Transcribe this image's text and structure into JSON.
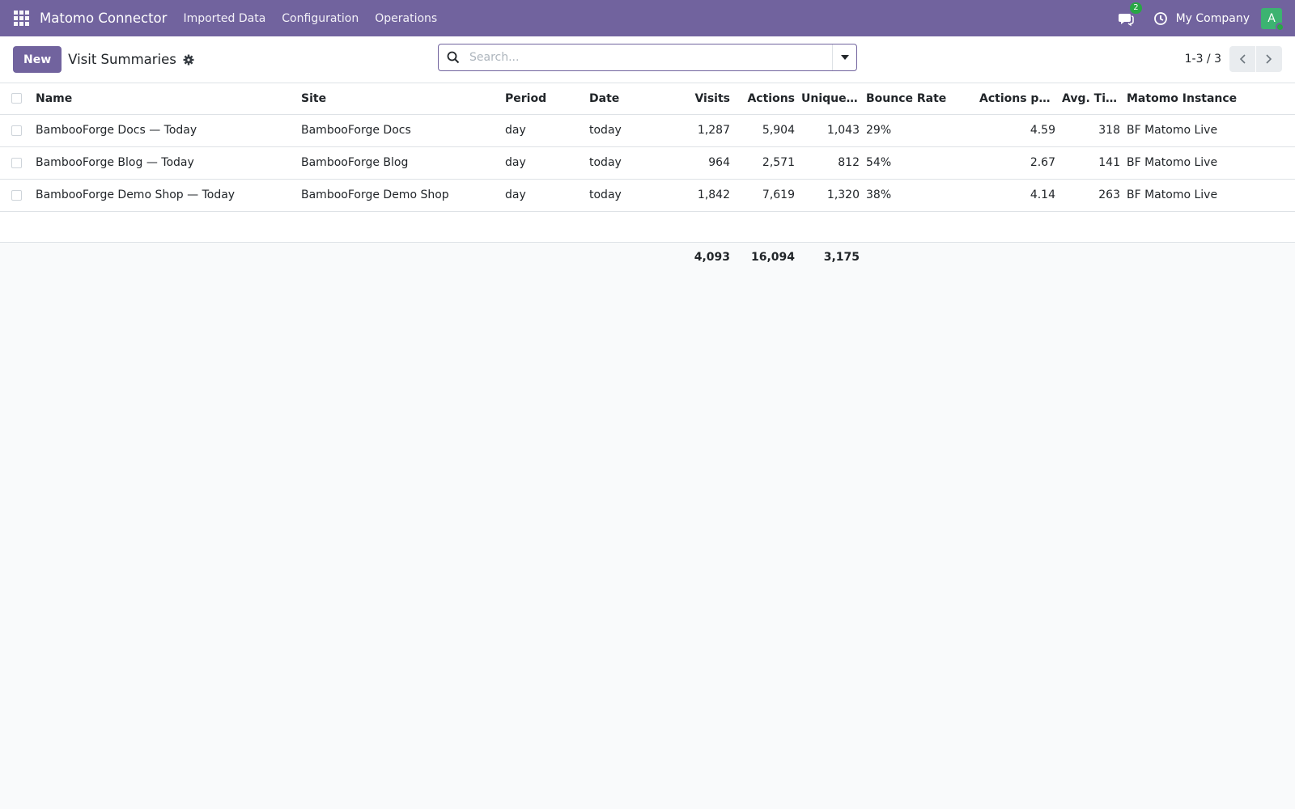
{
  "navbar": {
    "brand": "Matomo Connector",
    "menu": [
      "Imported Data",
      "Configuration",
      "Operations"
    ],
    "chat_count": "2",
    "company": "My Company",
    "avatar_letter": "A",
    "icons": [
      "apps-grid-icon",
      "chat-icon",
      "clock-icon"
    ],
    "color": "#71639e"
  },
  "control": {
    "new_label": "New",
    "title": "Visit Summaries",
    "search_placeholder": "Search...",
    "pager": "1-3 / 3"
  },
  "table": {
    "columns": [
      "Name",
      "Site",
      "Period",
      "Date",
      "Visits",
      "Actions",
      "Unique ...",
      "Bounce Rate",
      "Actions per ...",
      "Avg. Tim...",
      "Matomo Instance"
    ],
    "rows": [
      [
        "BambooForge Docs — Today",
        "BambooForge Docs",
        "day",
        "today",
        "1,287",
        "5,904",
        "1,043",
        "29%",
        "4.59",
        "318",
        "BF Matomo Live"
      ],
      [
        "BambooForge Blog — Today",
        "BambooForge Blog",
        "day",
        "today",
        "964",
        "2,571",
        "812",
        "54%",
        "2.67",
        "141",
        "BF Matomo Live"
      ],
      [
        "BambooForge Demo Shop — Today",
        "BambooForge Demo Shop",
        "day",
        "today",
        "1,842",
        "7,619",
        "1,320",
        "38%",
        "4.14",
        "263",
        "BF Matomo Live"
      ]
    ],
    "totals": {
      "visits": "4,093",
      "actions": "16,094",
      "unique": "3,175"
    }
  }
}
